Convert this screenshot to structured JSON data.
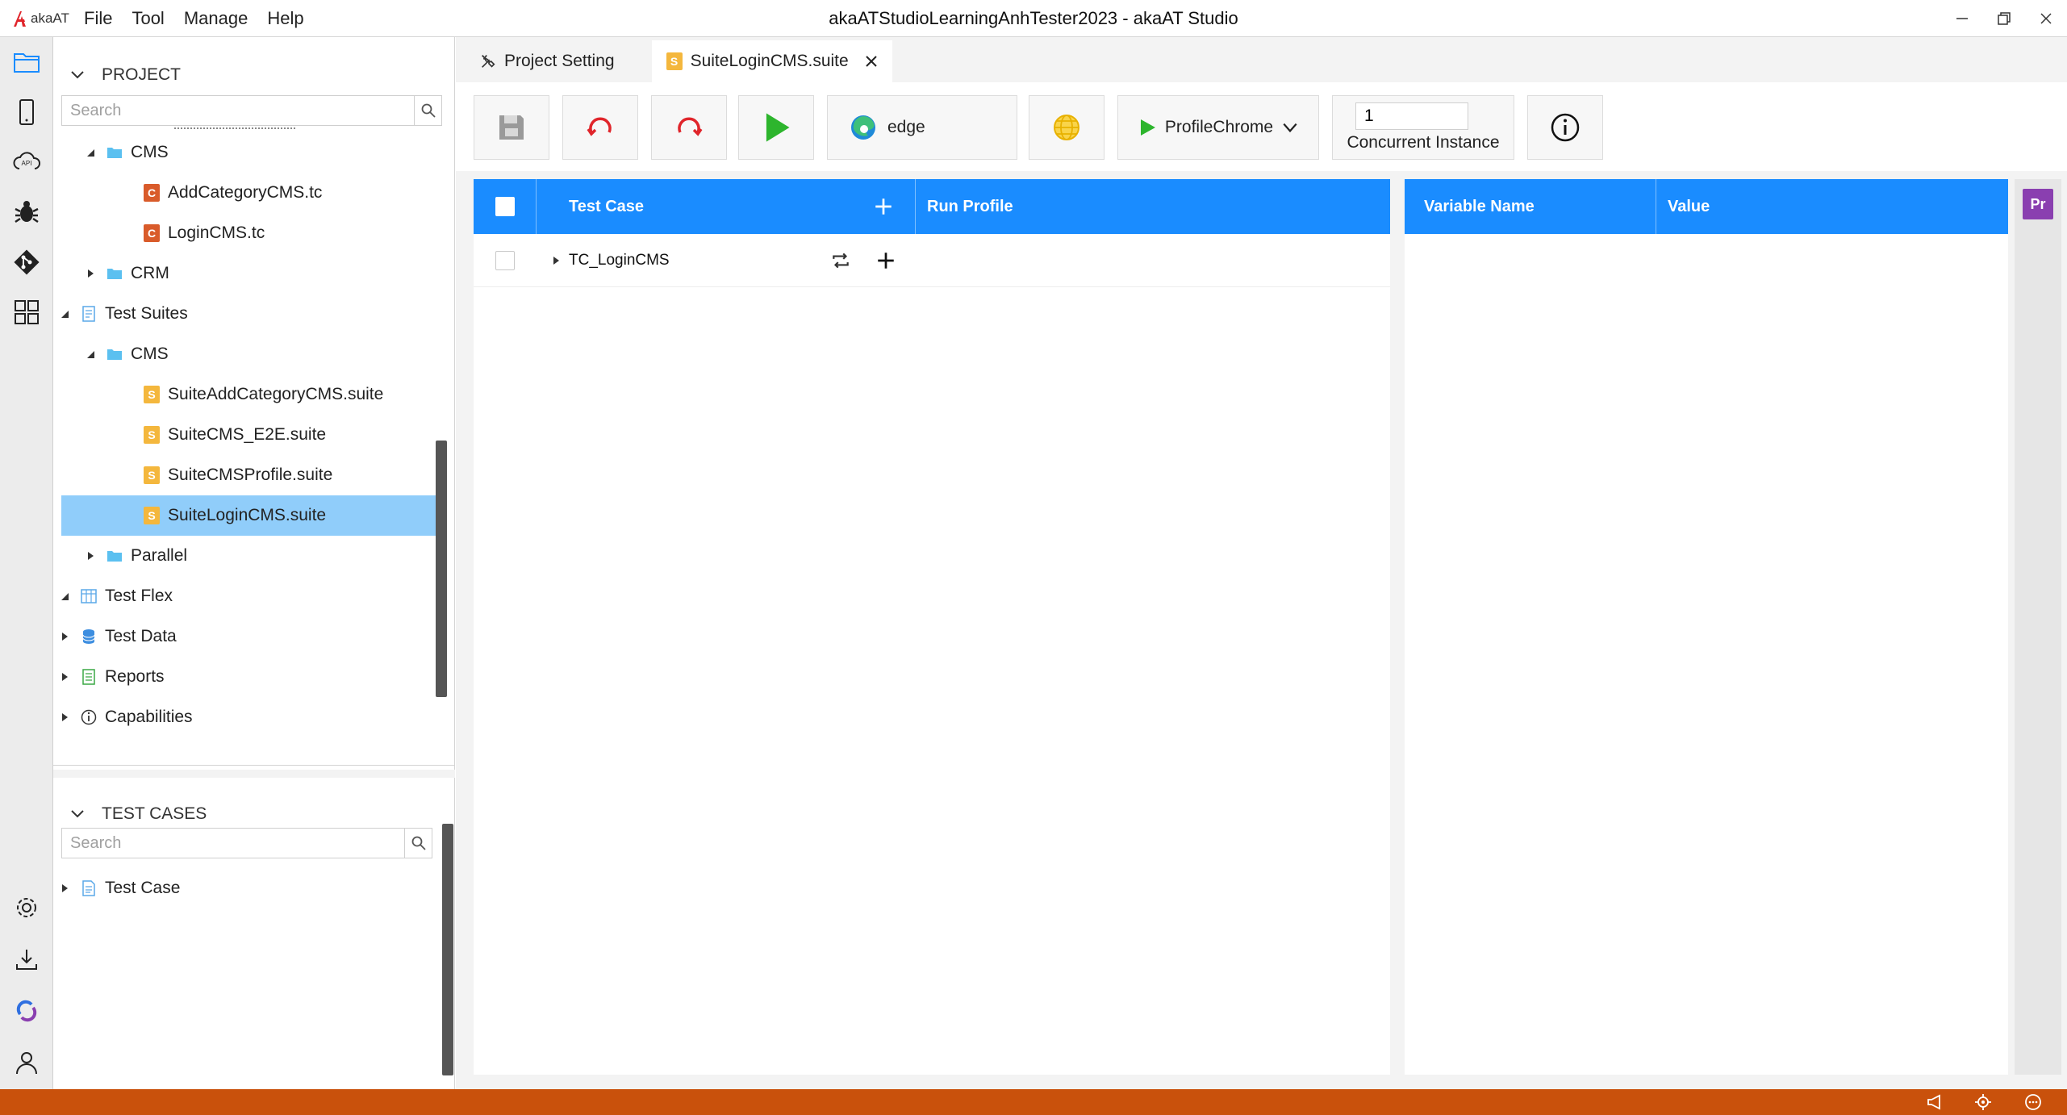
{
  "app": {
    "logo_text": "akaAT",
    "window_title": "akaATStudioLearningAnhTester2023 - akaAT Studio",
    "menu": [
      "File",
      "Tool",
      "Manage",
      "Help"
    ]
  },
  "project_panel": {
    "title": "PROJECT",
    "search_placeholder": "Search",
    "tree": [
      {
        "label": "CMS",
        "icon": "folder-icon",
        "expanded": true
      },
      {
        "label": "AddCategoryCMS.tc",
        "icon": "test-case-file-icon"
      },
      {
        "label": "LoginCMS.tc",
        "icon": "test-case-file-icon"
      },
      {
        "label": "CRM",
        "icon": "folder-icon",
        "expanded": false
      },
      {
        "label": "Test Suites",
        "icon": "test-suites-icon",
        "expanded": true
      },
      {
        "label": "CMS",
        "icon": "folder-icon",
        "expanded": true
      },
      {
        "label": "SuiteAddCategoryCMS.suite",
        "icon": "suite-file-icon"
      },
      {
        "label": "SuiteCMS_E2E.suite",
        "icon": "suite-file-icon"
      },
      {
        "label": "SuiteCMSProfile.suite",
        "icon": "suite-file-icon"
      },
      {
        "label": "SuiteLoginCMS.suite",
        "icon": "suite-file-icon",
        "selected": true
      },
      {
        "label": "Parallel",
        "icon": "folder-icon",
        "expanded": false
      },
      {
        "label": "Test Flex",
        "icon": "test-flex-icon",
        "expanded": true
      },
      {
        "label": "Test Data",
        "icon": "database-icon",
        "expanded": false
      },
      {
        "label": "Reports",
        "icon": "reports-icon",
        "expanded": false
      },
      {
        "label": "Capabilities",
        "icon": "info-icon",
        "expanded": false
      }
    ]
  },
  "test_cases_panel": {
    "title": "TEST CASES",
    "search_placeholder": "Search",
    "tree": [
      {
        "label": "Test Case",
        "icon": "document-icon",
        "expanded": false
      }
    ]
  },
  "tabs": [
    {
      "label": "Project Setting",
      "icon": "tools-icon",
      "active": false
    },
    {
      "label": "SuiteLoginCMS.suite",
      "icon": "suite-file-icon",
      "active": true
    }
  ],
  "toolbar": {
    "browser_label": "edge",
    "profile_label": "ProfileChrome",
    "concurrent_value": "1",
    "concurrent_label": "Concurrent Instance"
  },
  "test_grid": {
    "columns": {
      "test_case": "Test Case",
      "run_profile": "Run Profile"
    },
    "rows": [
      {
        "name": "TC_LoginCMS",
        "run_profile": ""
      }
    ]
  },
  "variables_grid": {
    "columns": {
      "name": "Variable Name",
      "value": "Value"
    },
    "rows": []
  },
  "right_rail": {
    "badge": "Pr"
  },
  "colors": {
    "accent": "#1a8cff",
    "selected_row": "#90cdfa",
    "status_bar": "#c9510c",
    "run_green": "#2db52d",
    "refresh_red": "#e0252b"
  }
}
